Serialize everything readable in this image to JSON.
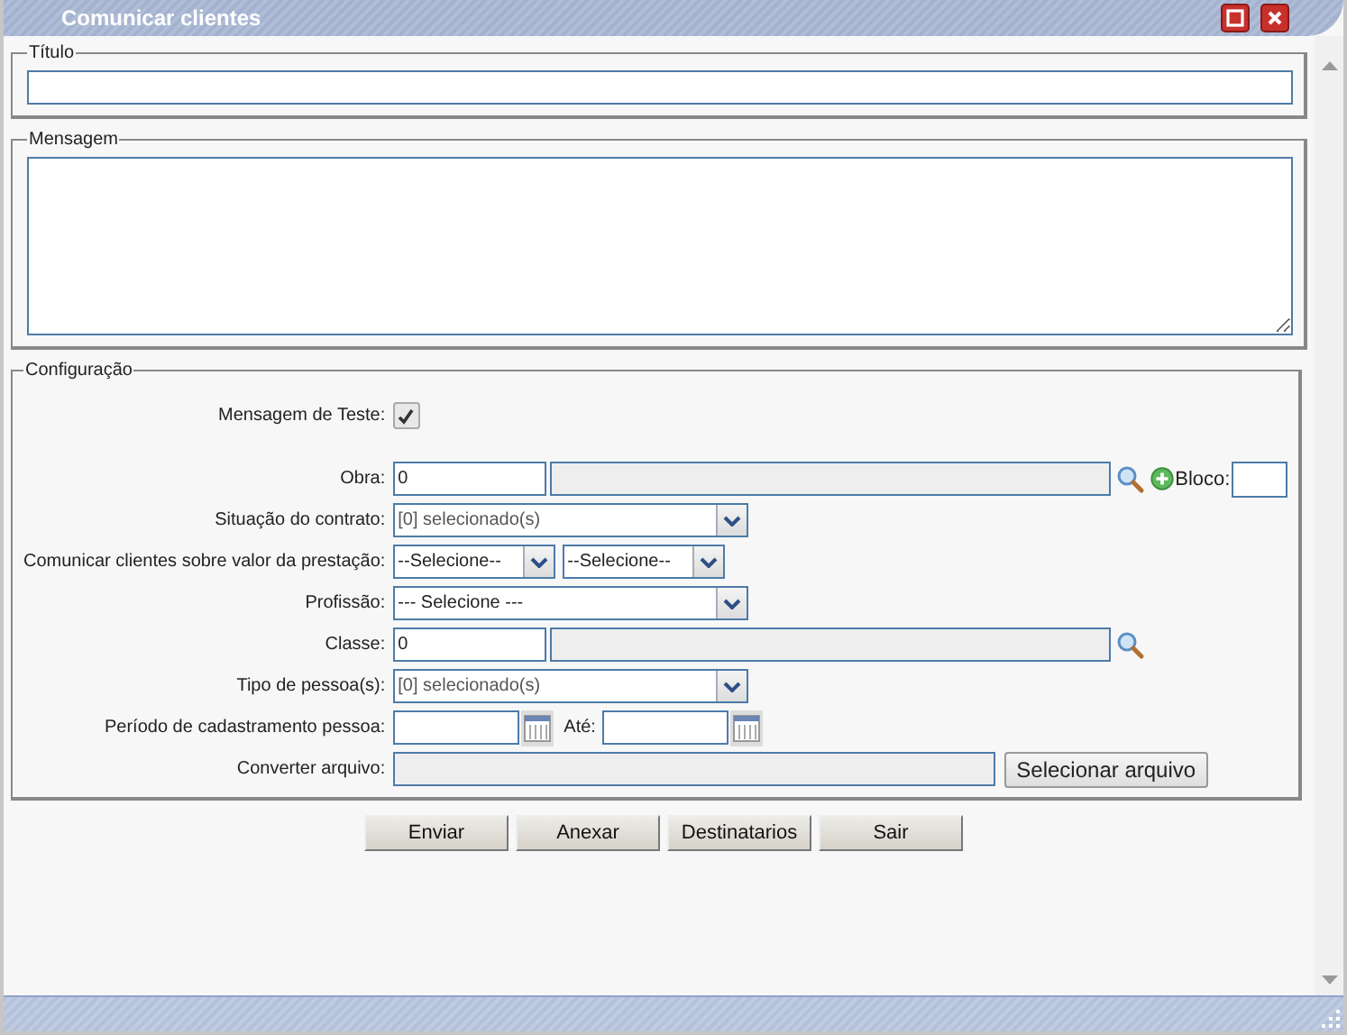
{
  "window": {
    "title": "Comunicar clientes"
  },
  "titulo": {
    "legend": "Título"
  },
  "mensagem": {
    "legend": "Mensagem"
  },
  "configuracao": {
    "legend": "Configuração",
    "fields": [
      {
        "kind": "checkbox",
        "label": "Mensagem de Teste:",
        "checked": true
      },
      {
        "kind": "lookup",
        "label": "Obra:",
        "value": "0",
        "extra_label": "Bloco:"
      },
      {
        "kind": "select",
        "label": "Situação do contrato:",
        "value": "[0] selecionado(s)"
      },
      {
        "kind": "select_pair",
        "label": "Comunicar clientes sobre valor da prestação:",
        "values": [
          "--Selecione--",
          "--Selecione--"
        ]
      },
      {
        "kind": "select",
        "label": "Profissão:",
        "value": "--- Selecione ---"
      },
      {
        "kind": "lookup",
        "label": "Classe:",
        "value": "0"
      },
      {
        "kind": "select",
        "label": "Tipo de pessoa(s):",
        "value": "[0] selecionado(s)"
      },
      {
        "kind": "date_range",
        "label": "Período de cadastramento pessoa:",
        "to_label": "Até:"
      },
      {
        "kind": "file",
        "label": "Converter arquivo:",
        "button": "Selecionar arquivo"
      }
    ]
  },
  "buttons": [
    "Enviar",
    "Anexar",
    "Destinatarios",
    "Sair"
  ]
}
